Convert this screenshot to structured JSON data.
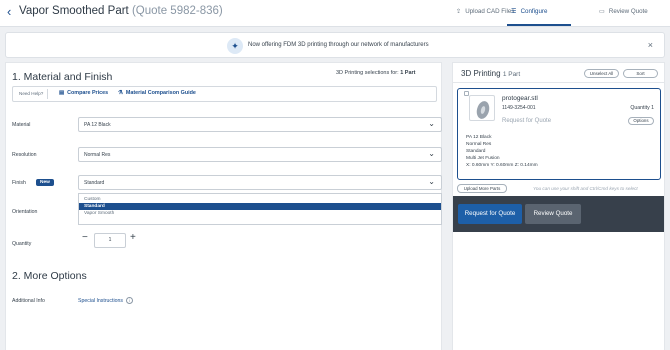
{
  "header": {
    "title": "Vapor Smoothed Part",
    "quote": "(Quote 5982-836)",
    "tabs": [
      {
        "label": "Upload CAD Files",
        "icon": "upload-icon"
      },
      {
        "label": "Configure",
        "icon": "sliders-icon",
        "active": true
      },
      {
        "label": "Review Quote",
        "icon": "cart-icon"
      }
    ]
  },
  "banner": {
    "text": "Now offering FDM 3D printing through our network of manufacturers",
    "icon": "sparkle-icon"
  },
  "material_section": {
    "heading": "1. Material and Finish",
    "selections_prefix": "3D Printing selections for: ",
    "selections_value": "1 Part",
    "help": {
      "label": "Need Help?",
      "compare": "Compare Prices",
      "guide": "Material Comparison Guide"
    },
    "material": {
      "label": "Material",
      "value": "PA 12 Black"
    },
    "resolution": {
      "label": "Resolution",
      "value": "Normal Res"
    },
    "finish": {
      "label": "Finish",
      "badge": "New",
      "value": "Standard",
      "options": [
        "Custom",
        "Standard",
        "Vapor Smooth"
      ]
    },
    "orientation": {
      "label": "Orientation"
    },
    "quantity": {
      "label": "Quantity",
      "value": "1"
    }
  },
  "more_options": {
    "heading": "2. More Options",
    "additional_info_label": "Additional Info",
    "special_instructions": "Special Instructions"
  },
  "right_panel": {
    "title": "3D Printing",
    "count": "1 Part",
    "unselect_all": "Unselect All",
    "sort": "Sort",
    "part": {
      "name": "protogear.stl",
      "id": "1149-3254-001",
      "quantity": "Quantity 1",
      "status": "Request for Quote",
      "options": "Options",
      "specs": [
        "PA 12 Black",
        "Normal Res",
        "Standard",
        "Multi Jet Fusion",
        "X: 0.60mm Y: 0.60mm Z: 0.14mm"
      ]
    },
    "upload_more": "Upload More Parts",
    "hint": "You can use your shift and Ctrl/Cmd keys to select",
    "request_button": "Request for Quote",
    "review_button": "Review Quote"
  },
  "colors": {
    "accent": "#1d4f8e",
    "footer_bg": "#37404b"
  }
}
